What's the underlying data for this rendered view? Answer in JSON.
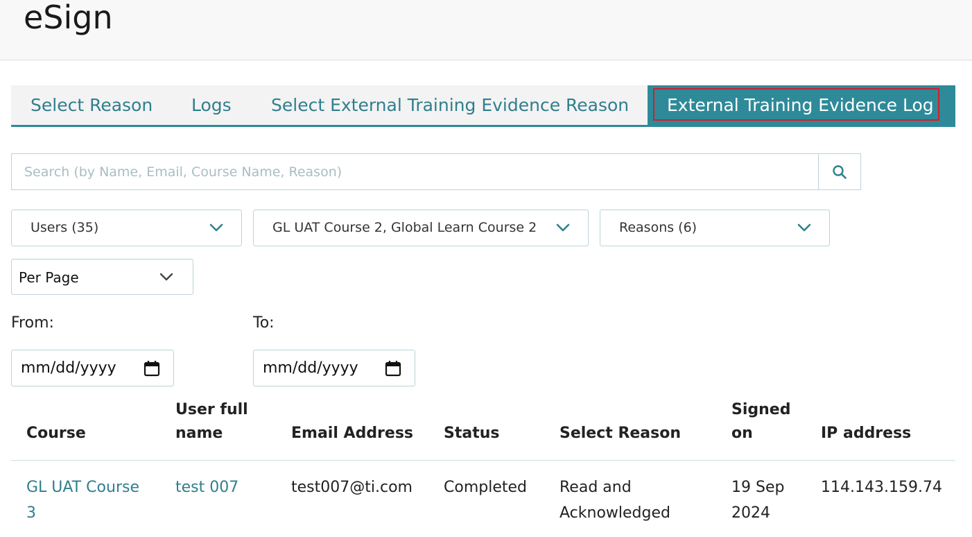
{
  "app": {
    "title": "eSign"
  },
  "tabs": [
    {
      "label": "Select Reason"
    },
    {
      "label": "Logs"
    },
    {
      "label": "Select External Training Evidence Reason"
    },
    {
      "label": "External Training Evidence Log",
      "active": true
    }
  ],
  "search": {
    "placeholder": "Search (by Name, Email, Course Name, Reason)",
    "value": ""
  },
  "filters": {
    "users": "Users (35)",
    "courses": "GL UAT Course 2, Global Learn Course 2",
    "reasons": "Reasons (6)",
    "per_page": "Per Page"
  },
  "dates": {
    "from_label": "From:",
    "to_label": "To:",
    "from_value": "mm/dd/yyyy",
    "to_value": "mm/dd/yyyy"
  },
  "table": {
    "columns": {
      "course": "Course",
      "user_full_name": [
        "User full",
        "name"
      ],
      "email": "Email Address",
      "status": "Status",
      "reason": "Select Reason",
      "signed_on": [
        "Signed",
        "on"
      ],
      "ip": "IP address"
    },
    "rows": [
      {
        "course": [
          "GL UAT Course",
          "3"
        ],
        "user_full_name": "test 007",
        "email": "test007@ti.com",
        "status": "Completed",
        "reason": [
          "Read and",
          "Acknowledged"
        ],
        "signed_on": [
          "19 Sep",
          "2024"
        ],
        "ip": "114.143.159.74"
      }
    ]
  },
  "colors": {
    "accent": "#2e8a99",
    "link": "#2f7f8d",
    "focus": "#d0202a",
    "border": "#b9d3d8"
  }
}
